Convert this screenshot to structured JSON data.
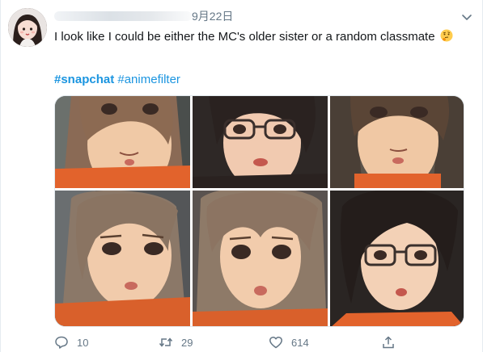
{
  "tweet": {
    "date": "9月22日",
    "text": "I look like I could be either the MC's older sister or a random classmate",
    "emoji": "thinking-face",
    "hashtags": [
      "#snapchat",
      "#animefilter"
    ]
  },
  "actions": {
    "reply_count": "10",
    "retweet_count": "29",
    "like_count": "614"
  },
  "colors": {
    "link": "#1b95e0",
    "muted": "#657786",
    "accent_orange": "#e2632c"
  }
}
